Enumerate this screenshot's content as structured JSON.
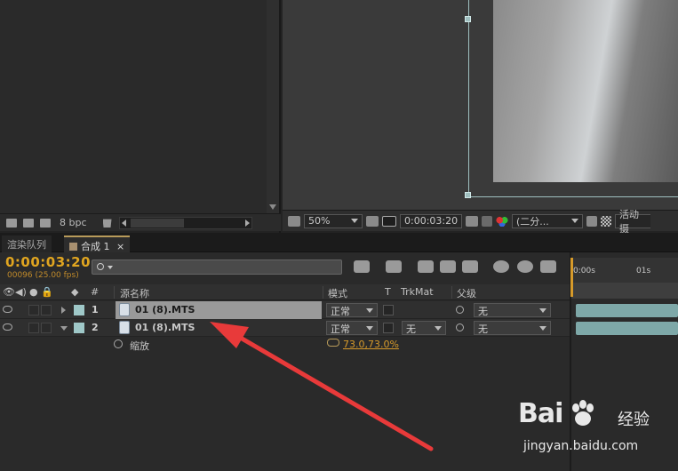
{
  "project": {
    "bpc": "8 bpc"
  },
  "viewer": {
    "zoom": "50%",
    "timecode": "0:00:03:20",
    "resolution": "(二分...",
    "active_camera": "活动摄"
  },
  "tabs": {
    "render_queue": "渲染队列",
    "composition": "合成 1",
    "close": "×"
  },
  "timeline": {
    "current_time": "0:00:03:20",
    "fps_info": "00096 (25.00 fps)",
    "ruler": {
      "start": "0:00s",
      "mark": "01s"
    },
    "columns": {
      "number": "#",
      "source_name": "源名称",
      "mode": "模式",
      "t": "T",
      "trkmat": "TrkMat",
      "parent": "父级"
    },
    "layers": [
      {
        "number": "1",
        "name": "01 (8).MTS",
        "mode": "正常",
        "trkmat": "",
        "parent": "无"
      },
      {
        "number": "2",
        "name": "01 (8).MTS",
        "mode": "正常",
        "trkmat": "无",
        "parent": "无"
      }
    ],
    "property": {
      "name": "缩放",
      "value": "73.0,73.0%"
    }
  },
  "watermark": {
    "logo": "Bai",
    "logo_cn": "经验",
    "url": "jingyan.baidu.com"
  },
  "colors": {
    "accent_orange": "#e0a520",
    "layer_label": "#9fc8c8",
    "annotation_arrow": "#e83a3a"
  }
}
